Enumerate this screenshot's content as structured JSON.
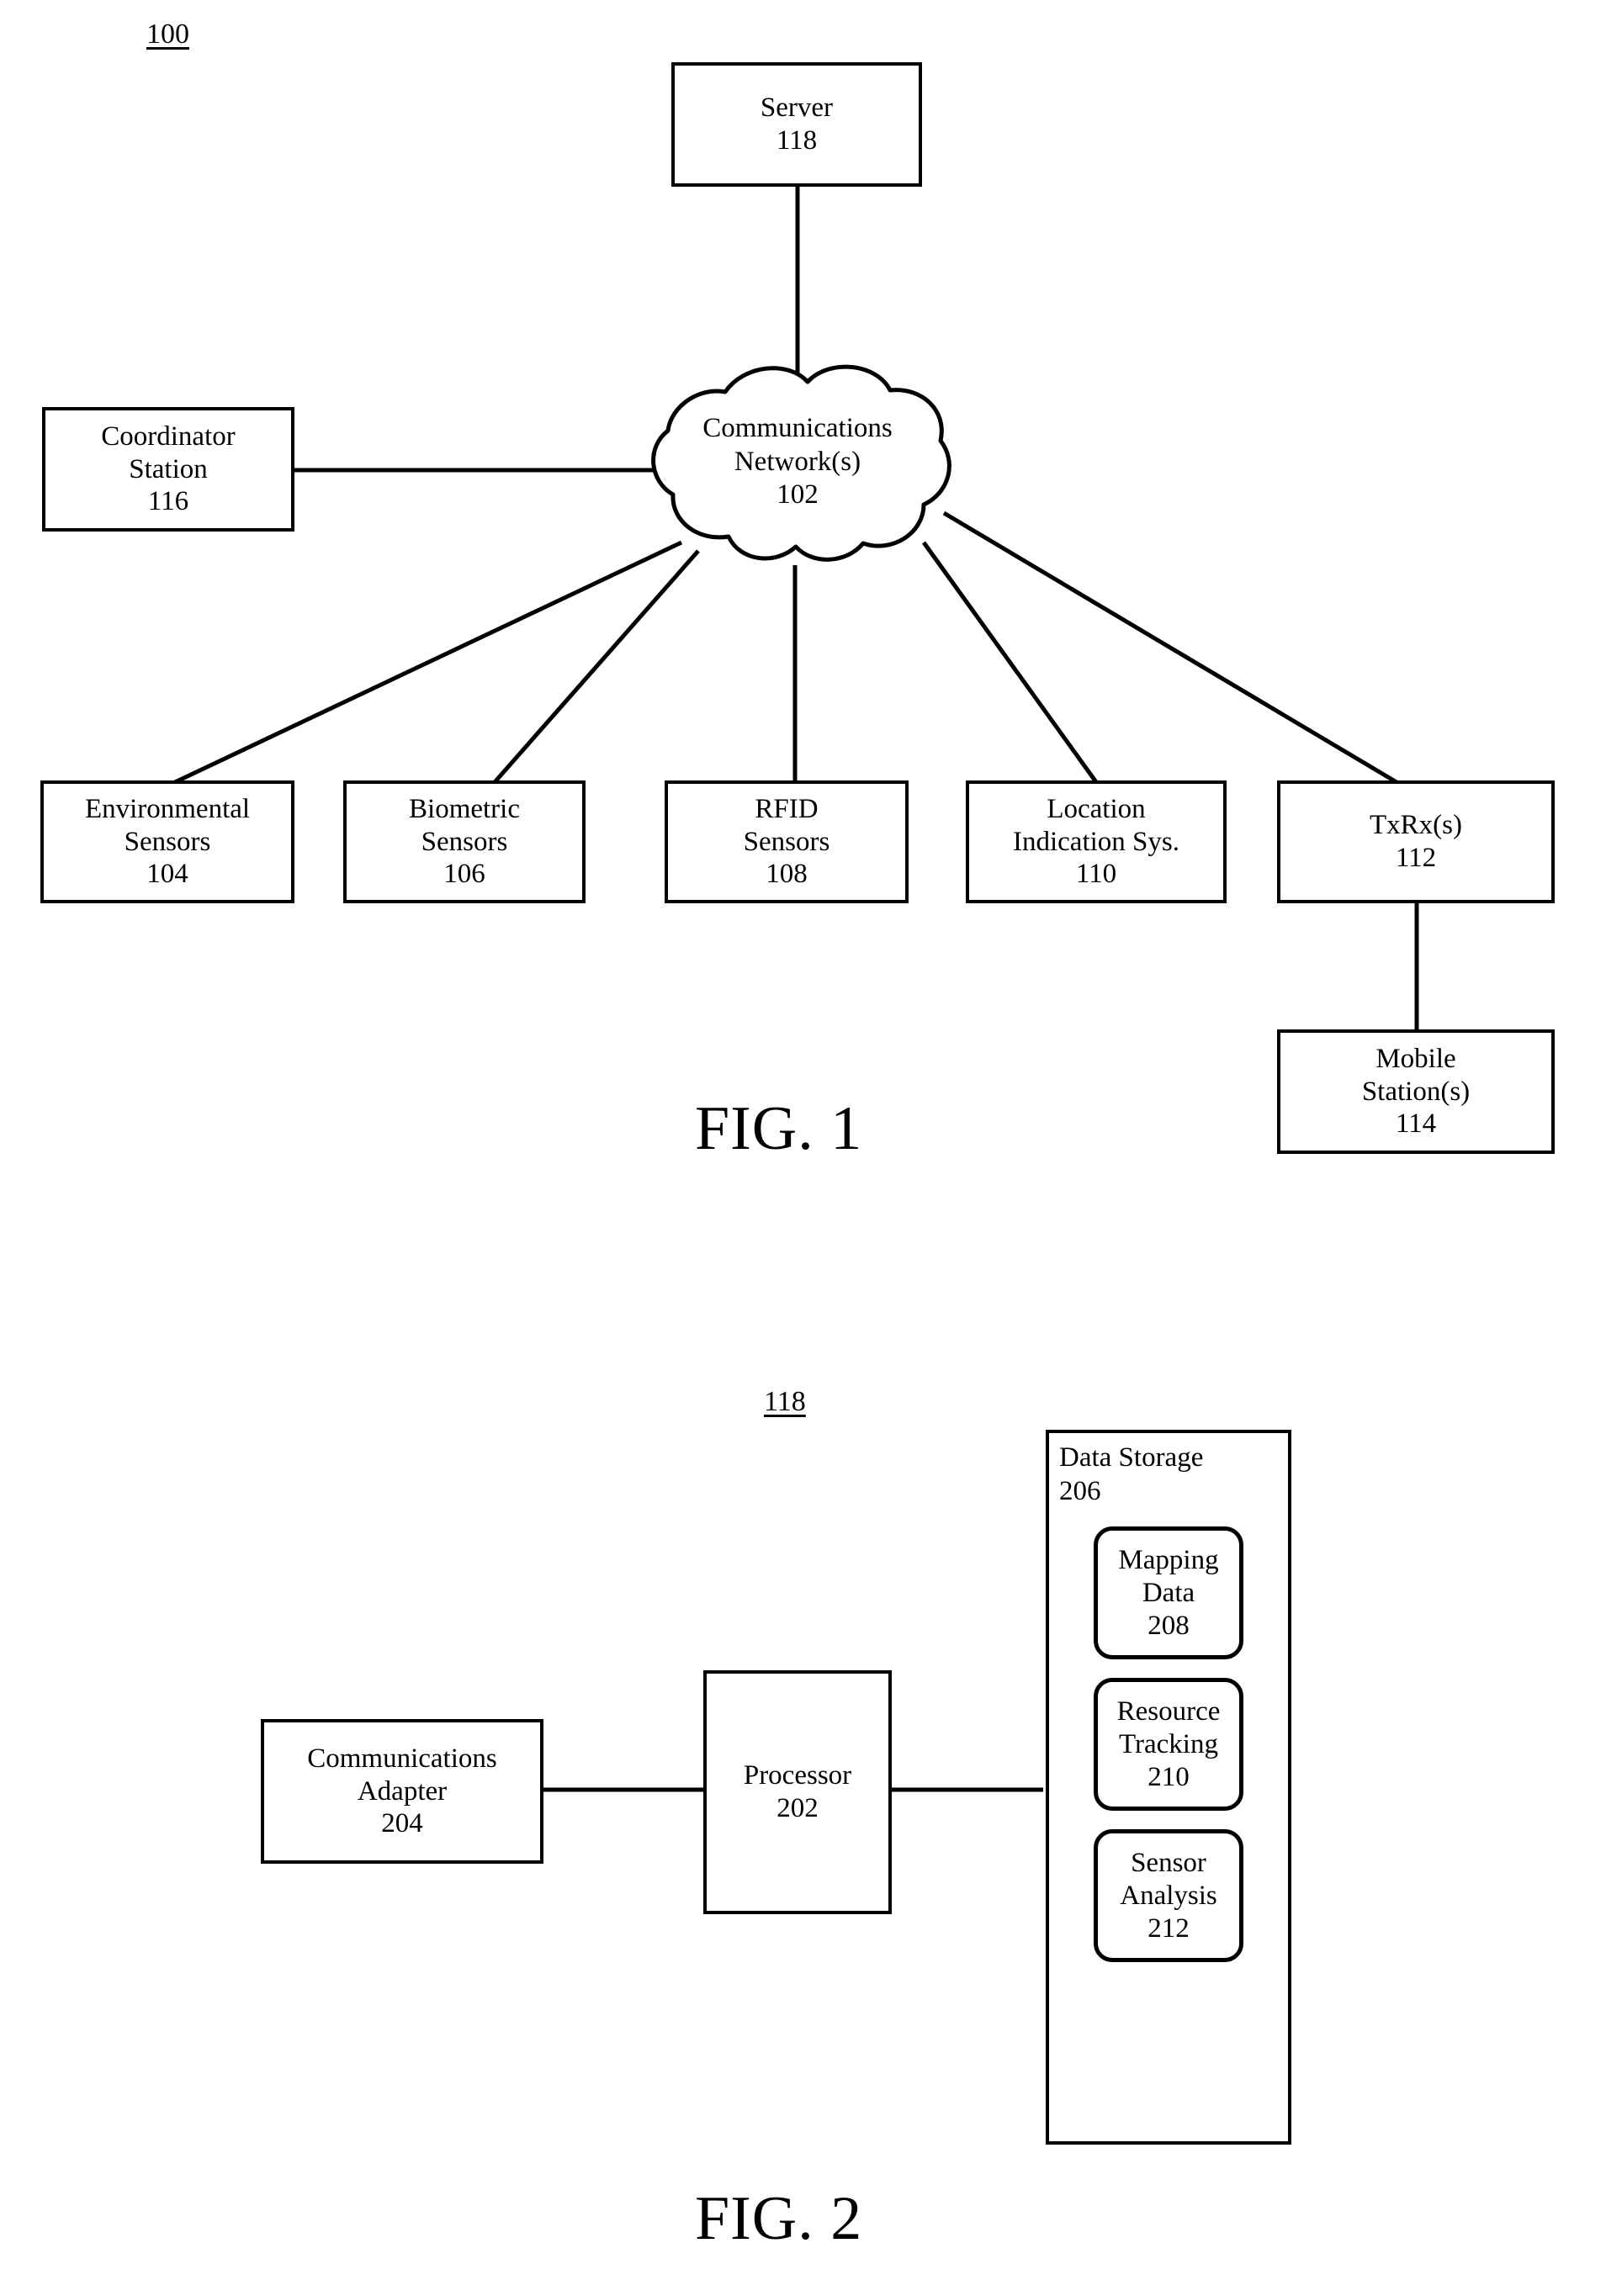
{
  "figures": [
    {
      "id": "fig1",
      "caption": "FIG. 1",
      "ref_label": "100",
      "nodes": {
        "server": {
          "lines": [
            "Server",
            "118"
          ]
        },
        "network": {
          "lines": [
            "Communications",
            "Network(s)",
            "102"
          ]
        },
        "coordinator": {
          "lines": [
            "Coordinator",
            "Station",
            "116"
          ]
        },
        "environmental": {
          "lines": [
            "Environmental",
            "Sensors",
            "104"
          ]
        },
        "biometric": {
          "lines": [
            "Biometric",
            "Sensors",
            "106"
          ]
        },
        "rfid": {
          "lines": [
            "RFID",
            "Sensors",
            "108"
          ]
        },
        "location": {
          "lines": [
            "Location",
            "Indication Sys.",
            "110"
          ]
        },
        "txrx": {
          "lines": [
            "TxRx(s)",
            "112"
          ]
        },
        "mobile": {
          "lines": [
            "Mobile",
            "Station(s)",
            "114"
          ]
        }
      }
    },
    {
      "id": "fig2",
      "caption": "FIG. 2",
      "ref_label": "118",
      "nodes": {
        "comm_adapter": {
          "lines": [
            "Communications",
            "Adapter",
            "204"
          ]
        },
        "processor": {
          "lines": [
            "Processor",
            "202"
          ]
        },
        "data_storage": {
          "lines": [
            "Data Storage",
            "206"
          ]
        },
        "mapping_data": {
          "lines": [
            "Mapping",
            "Data",
            "208"
          ]
        },
        "resource_tracking": {
          "lines": [
            "Resource",
            "Tracking",
            "210"
          ]
        },
        "sensor_analysis": {
          "lines": [
            "Sensor",
            "Analysis",
            "212"
          ]
        }
      }
    }
  ],
  "colors": {
    "stroke": "#000000",
    "fill": "#ffffff"
  }
}
